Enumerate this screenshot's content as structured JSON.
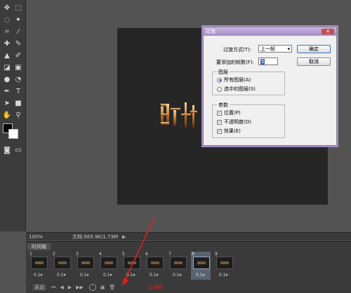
{
  "status": {
    "zoom": "100%",
    "doc_size": "文档:585.9K/1.73M"
  },
  "timeline": {
    "tab_label": "时间轴",
    "frames": [
      {
        "num": "1",
        "delay": "0.1▾"
      },
      {
        "num": "2",
        "delay": "0.1▾"
      },
      {
        "num": "3",
        "delay": "0.1▾"
      },
      {
        "num": "4",
        "delay": "0.1▾"
      },
      {
        "num": "5",
        "delay": "0.1▾"
      },
      {
        "num": "6",
        "delay": "0.1▾"
      },
      {
        "num": "7",
        "delay": "0.1▾"
      },
      {
        "num": "8",
        "delay": "0.1▾"
      },
      {
        "num": "9",
        "delay": "0.1▾"
      }
    ],
    "loop_value": "永远",
    "annotation": "过渡帧"
  },
  "dialog": {
    "title": "过渡",
    "close_icon": "✕",
    "tween_with_label": "过渡方式(T):",
    "tween_with_value": "上一帧",
    "frames_label": "要添加的帧数(F):",
    "frames_value": "5",
    "ok_label": "确定",
    "cancel_label": "取消",
    "layers_title": "图层",
    "layers_all": "所有图层(A)",
    "layers_selected": "选中的图层(S)",
    "params_title": "参数",
    "param_position": "位置(P)",
    "param_opacity": "不透明度(O)",
    "param_effects": "效果(E)"
  },
  "canvas": {
    "art_text": "叶子"
  },
  "colors": {
    "dialog_accent": "#a78ac4",
    "annotation_red": "#e02020",
    "canvas_bg": "#262626"
  }
}
